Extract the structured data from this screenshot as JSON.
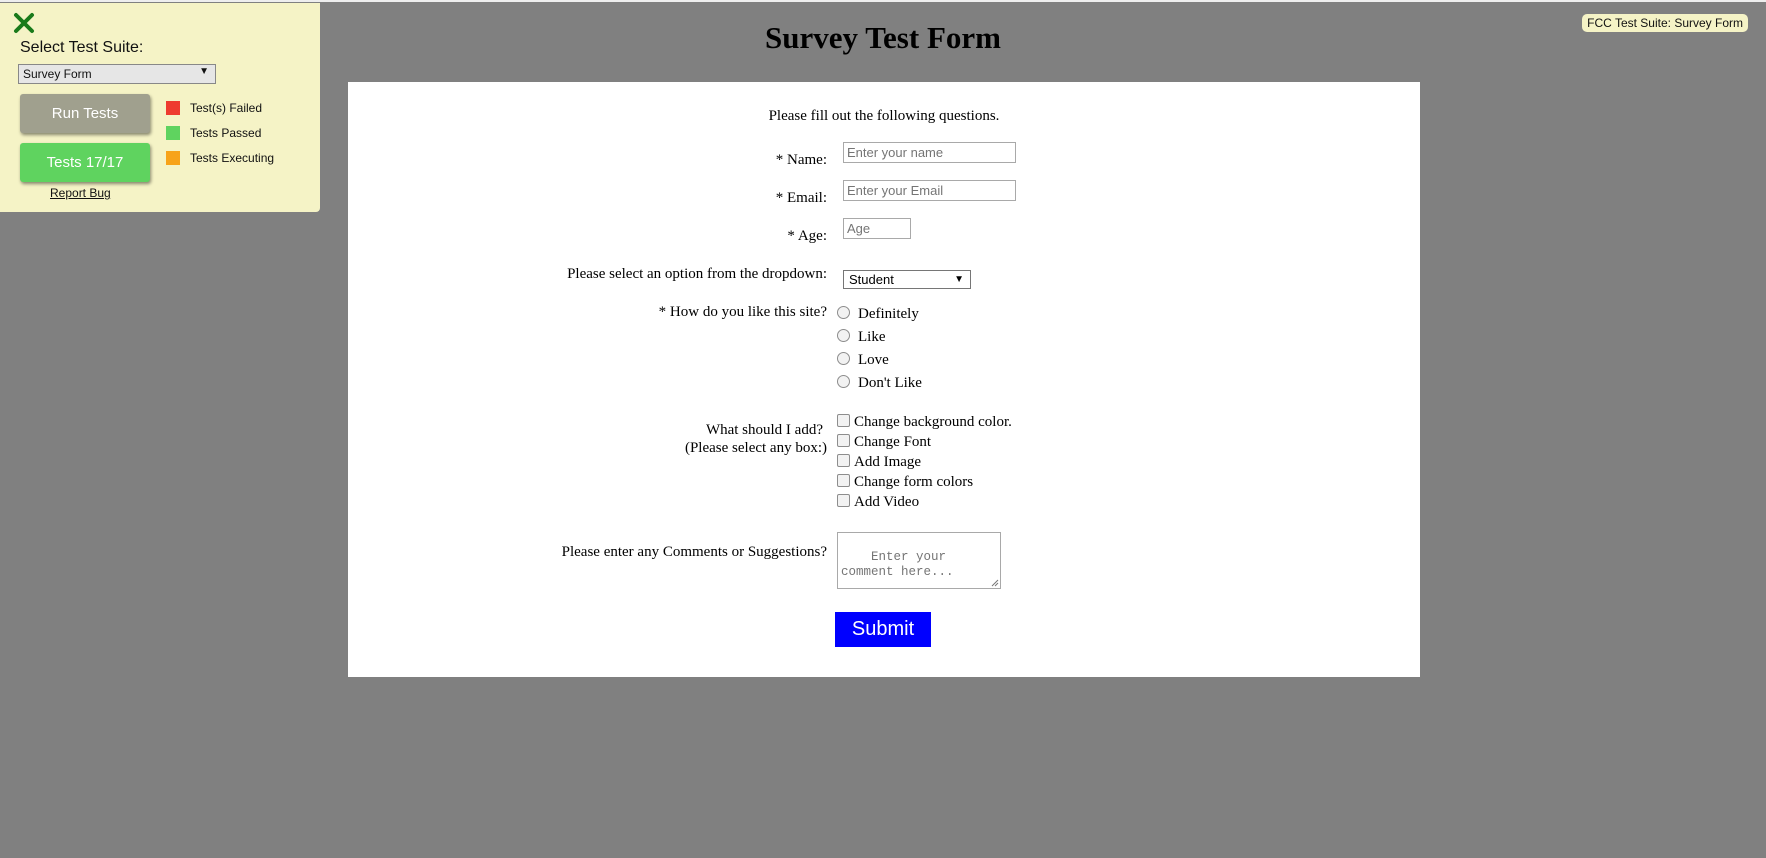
{
  "test_panel": {
    "select_label": "Select Test Suite:",
    "selected_suite": "Survey Form",
    "run_button": "Run Tests",
    "tests_button": "Tests 17/17",
    "report_link": "Report Bug",
    "legend": [
      {
        "label": "Test(s) Failed",
        "color": "#ee3b2f"
      },
      {
        "label": "Tests Passed",
        "color": "#5fd35f"
      },
      {
        "label": "Tests Executing",
        "color": "#f7a31a"
      }
    ]
  },
  "badge": "FCC Test Suite: Survey Form",
  "page": {
    "title": "Survey Test Form",
    "intro": "Please fill out the following questions."
  },
  "form": {
    "name_label": "* Name:",
    "name_placeholder": "Enter your name",
    "email_label": "* Email:",
    "email_placeholder": "Enter your Email",
    "age_label": "* Age:",
    "age_placeholder": "Age",
    "dropdown_label": "Please select an option from the dropdown:",
    "dropdown_selected": "Student",
    "radio_label": "* How do you like this site?",
    "radio_options": [
      "Definitely",
      "Like",
      "Love",
      "Don't Like"
    ],
    "checkbox_label_1": "What should I add?",
    "checkbox_label_2": "(Please select any box:)",
    "checkbox_options": [
      "Change background color.",
      "Change Font",
      "Add Image",
      "Change form colors",
      "Add Video"
    ],
    "comments_label": "Please enter any Comments or Suggestions?",
    "comments_placeholder": "Enter your comment here...",
    "submit": "Submit"
  }
}
